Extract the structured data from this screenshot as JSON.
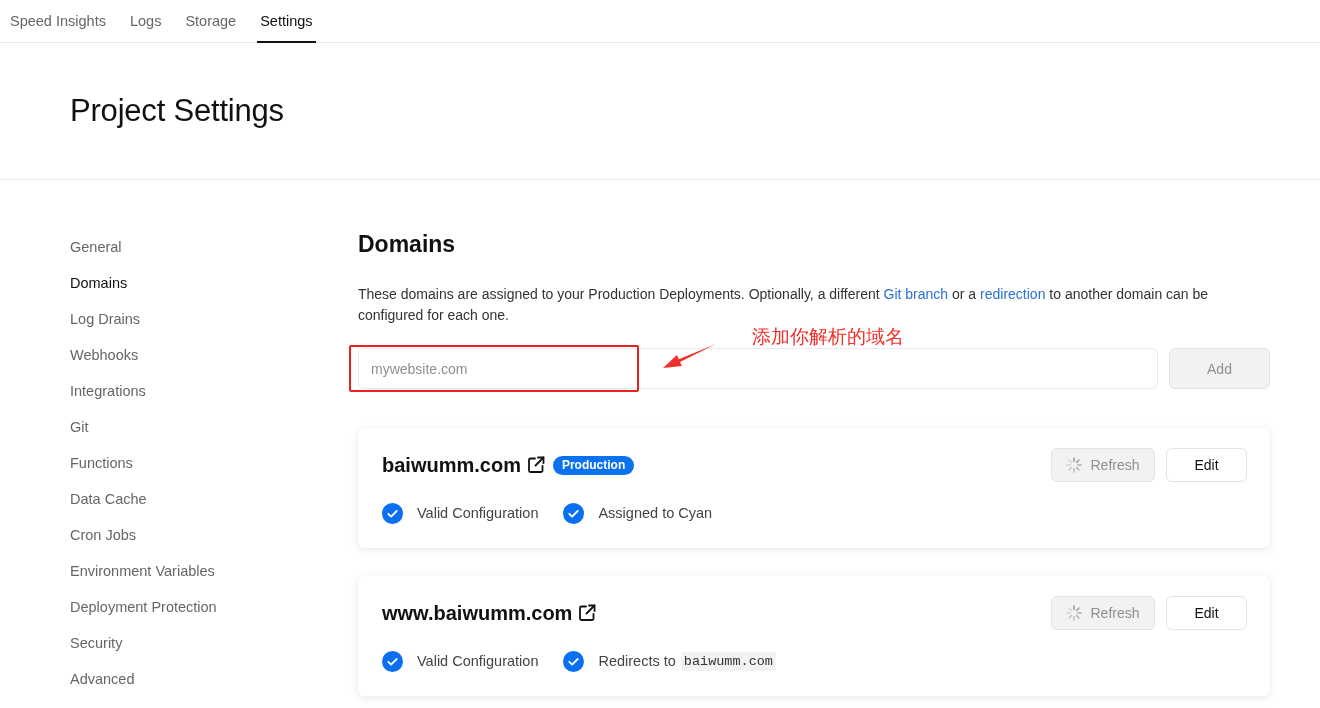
{
  "top_tabs": [
    {
      "label": "Speed Insights",
      "selected": false
    },
    {
      "label": "Logs",
      "selected": false
    },
    {
      "label": "Storage",
      "selected": false
    },
    {
      "label": "Settings",
      "selected": true
    }
  ],
  "page_title": "Project Settings",
  "sidebar": {
    "items": [
      {
        "label": "General",
        "selected": false
      },
      {
        "label": "Domains",
        "selected": true
      },
      {
        "label": "Log Drains",
        "selected": false
      },
      {
        "label": "Webhooks",
        "selected": false
      },
      {
        "label": "Integrations",
        "selected": false
      },
      {
        "label": "Git",
        "selected": false
      },
      {
        "label": "Functions",
        "selected": false
      },
      {
        "label": "Data Cache",
        "selected": false
      },
      {
        "label": "Cron Jobs",
        "selected": false
      },
      {
        "label": "Environment Variables",
        "selected": false
      },
      {
        "label": "Deployment Protection",
        "selected": false
      },
      {
        "label": "Security",
        "selected": false
      },
      {
        "label": "Advanced",
        "selected": false
      }
    ]
  },
  "section": {
    "title": "Domains",
    "description": [
      {
        "kind": "text",
        "text": "These domains are assigned to your Production Deployments. Optionally, a different "
      },
      {
        "kind": "link",
        "text": "Git branch"
      },
      {
        "kind": "text",
        "text": " or a "
      },
      {
        "kind": "link",
        "text": "redirection"
      },
      {
        "kind": "text",
        "text": " to another domain can be configured for each one."
      }
    ]
  },
  "domain_input": {
    "placeholder": "mywebsite.com"
  },
  "add_button": {
    "label": "Add",
    "disabled": true
  },
  "annotation": {
    "text": "添加你解析的域名"
  },
  "domains": [
    {
      "name": "baiwumm.com",
      "badge": "Production",
      "refresh_button": {
        "label": "Refresh",
        "disabled": true
      },
      "edit_button": {
        "label": "Edit",
        "disabled": false
      },
      "checks": [
        {
          "kind": "status",
          "label": "Valid Configuration",
          "checked": true
        },
        {
          "kind": "status",
          "label": "Assigned to Cyan",
          "checked": true
        }
      ]
    },
    {
      "name": "www.baiwumm.com",
      "refresh_button": {
        "label": "Refresh",
        "disabled": true
      },
      "edit_button": {
        "label": "Edit",
        "disabled": false
      },
      "checks": [
        {
          "kind": "status",
          "label": "Valid Configuration",
          "checked": true
        },
        {
          "kind": "redirect",
          "label": "Redirects to",
          "target": "baiwumm.com",
          "checked": true
        }
      ]
    }
  ]
}
